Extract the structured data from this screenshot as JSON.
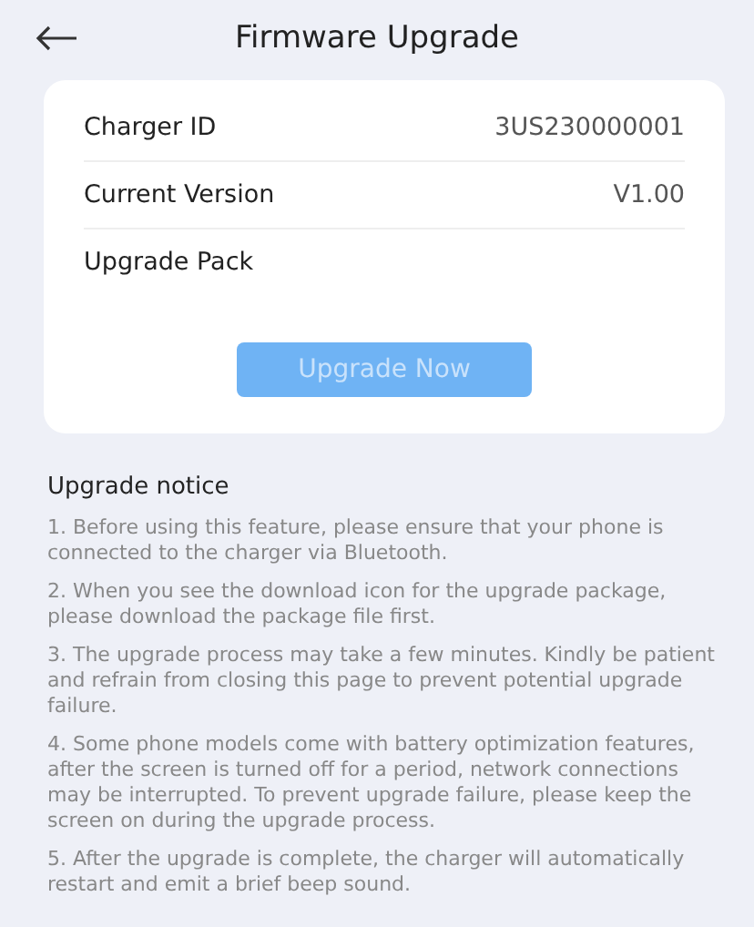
{
  "header": {
    "title": "Firmware Upgrade"
  },
  "info": [
    {
      "label": "Charger ID",
      "value": "3US230000001"
    },
    {
      "label": "Current Version",
      "value": "V1.00"
    },
    {
      "label": "Upgrade Pack"
    }
  ],
  "upgrade_button": {
    "label": "Upgrade Now",
    "disabled": true
  },
  "notice": {
    "title": "Upgrade notice",
    "items": [
      "1. Before using this feature, please ensure that your phone is connected to the charger via Bluetooth.",
      "2. When you see the download icon for the upgrade package, please download the package file first.",
      "3. The upgrade process may take a few minutes. Kindly be patient and refrain from closing this page to prevent potential upgrade failure.",
      "4. Some phone models come with battery optimization features, after the screen is turned off for a period, network connections may be interrupted. To prevent upgrade failure, please keep the screen on during the upgrade process.",
      "5. After the upgrade is complete, the charger will automatically restart and emit a brief beep sound."
    ]
  }
}
